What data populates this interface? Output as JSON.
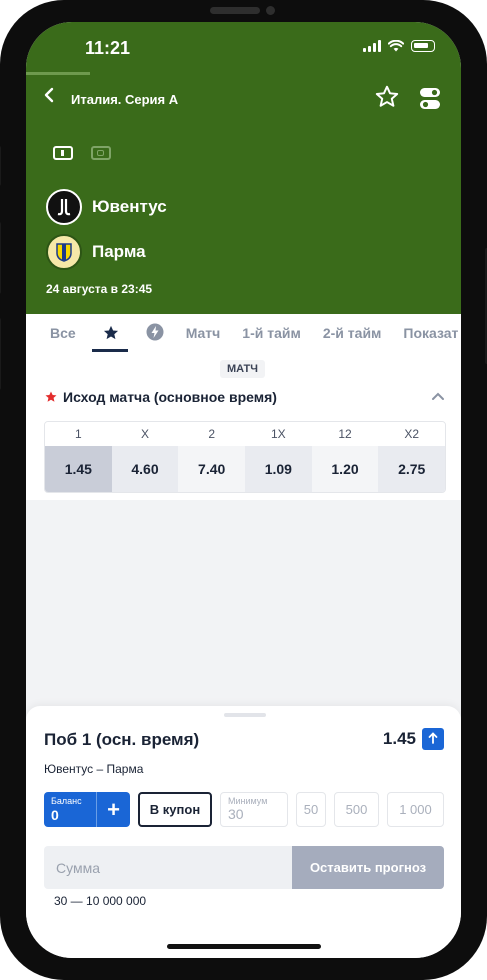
{
  "status": {
    "time": "11:21"
  },
  "header": {
    "league": "Италия. Серия А",
    "teams": [
      {
        "name": "Ювентус"
      },
      {
        "name": "Парма"
      }
    ],
    "date": "24 августа в 23:45"
  },
  "tabs": [
    "Все",
    "Матч",
    "1-й тайм",
    "2-й тайм",
    "Показат"
  ],
  "section": {
    "label": "МАТЧ"
  },
  "market": {
    "title": "Исход матча (основное время)",
    "columns": [
      "1",
      "X",
      "2",
      "1X",
      "12",
      "X2"
    ],
    "odds": [
      "1.45",
      "4.60",
      "7.40",
      "1.09",
      "1.20",
      "2.75"
    ]
  },
  "betslip": {
    "title": "Поб 1 (осн. время)",
    "odds": "1.45",
    "match": "Ювентус – Парма",
    "balance_label": "Баланс",
    "balance_value": "0",
    "coupon_button": "В купон",
    "min_label": "Минимум",
    "min_value": "30",
    "chips": [
      "50",
      "500",
      "1 000"
    ],
    "sum_placeholder": "Сумма",
    "submit_label": "Оставить прогноз",
    "range": "30 — 10 000 000"
  },
  "colors": {
    "header_bg": "#3a6b1a",
    "accent_blue": "#1a66d6",
    "star_red": "#e32d2d",
    "text_dark": "#1a2335"
  }
}
